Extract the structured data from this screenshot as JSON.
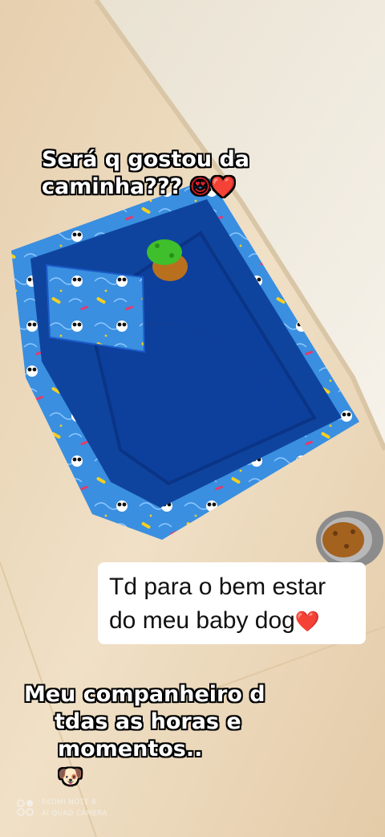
{
  "caption_top": {
    "line1": "Será q gostou da",
    "line2": "caminha???",
    "emoji": "😍❤️"
  },
  "caption_box": {
    "line1": "Td para o bem estar",
    "line2": "do meu baby dog",
    "emoji": "❤️"
  },
  "caption_bottom": {
    "line1": "Meu companheiro d",
    "line2": "tdas as horas e",
    "line3": "momentos..",
    "emoji": "🐶"
  },
  "watermark": {
    "line1": "REDMI NOTE 8",
    "line2": "AI QUAD CAMERA"
  },
  "colors": {
    "bed_blue": "#0d3f9c",
    "bed_print": "#3a8fe0",
    "floor": "#e9d8bf",
    "wall": "#efe9dc",
    "caption_box_bg": "#ffffff"
  }
}
